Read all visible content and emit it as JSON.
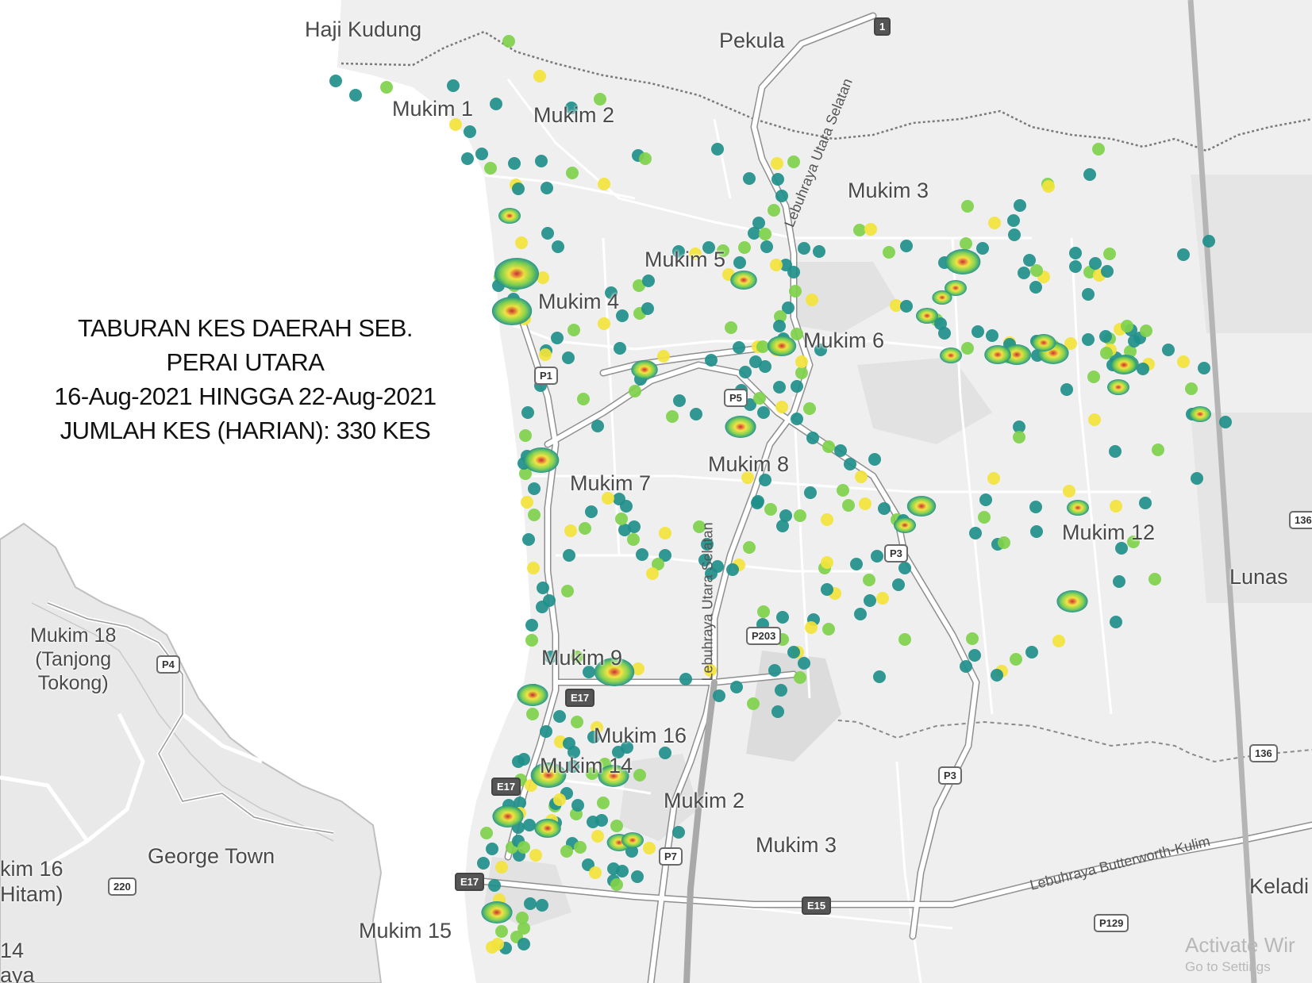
{
  "info": {
    "line1": "TABURAN KES DAERAH SEB.",
    "line2": "PERAI UTARA",
    "line3": "16-Aug-2021 HINGGA 22-Aug-2021",
    "line4": "JUMLAH KES (HARIAN): 330 KES"
  },
  "places": {
    "haji_kudung": "Haji Kudung",
    "pekula": "Pekula",
    "mukim1": "Mukim 1",
    "mukim2_north": "Mukim 2",
    "mukim3_north": "Mukim 3",
    "mukim5": "Mukim 5",
    "mukim4": "Mukim 4",
    "mukim6": "Mukim 6",
    "mukim7": "Mukim 7",
    "mukim8": "Mukim 8",
    "mukim12": "Mukim 12",
    "lunas": "Lunas",
    "mukim18": "Mukim 18",
    "tanjong": "(Tanjong",
    "tokong": "Tokong)",
    "mukim9": "Mukim 9",
    "mukim16": "Mukim 16",
    "mukim14": "Mukim 14",
    "mukim2_south": "Mukim 2",
    "mukim3_south": "Mukim 3",
    "george_town": "George Town",
    "kim16": "kim 16",
    "hitam": "Hitam)",
    "mukim15": "Mukim 15",
    "keladi": "Keladi",
    "n14": "14",
    "aya": "aya"
  },
  "roads": {
    "shield_1": "1",
    "shield_p1": "P1",
    "shield_p5": "P5",
    "shield_p3a": "P3",
    "shield_p3b": "P3",
    "shield_p203": "P203",
    "shield_p4": "P4",
    "shield_e17a": "E17",
    "shield_e17b": "E17",
    "shield_e17c": "E17",
    "shield_p7": "P7",
    "shield_e15": "E15",
    "shield_p129": "P129",
    "shield_220": "220",
    "shield_136a": "136",
    "shield_136b": "136",
    "lus_north": "Lebuhraya Utara Selatan",
    "lus_south": "Lebuhraya Utara Selatan",
    "butterworth_kulim": "Lebuhraya Butterworth-Kulim"
  },
  "watermark": {
    "line1": "Activate Wir",
    "line2": "Go to Settings"
  },
  "colors": {
    "land": "#efefef",
    "water": "#ffffff",
    "road": "#ffffff",
    "heat_low": "#1f8f8a",
    "heat_mid": "#7fd14b",
    "heat_high": "#f2e33b",
    "heat_peak": "#d0222a"
  }
}
